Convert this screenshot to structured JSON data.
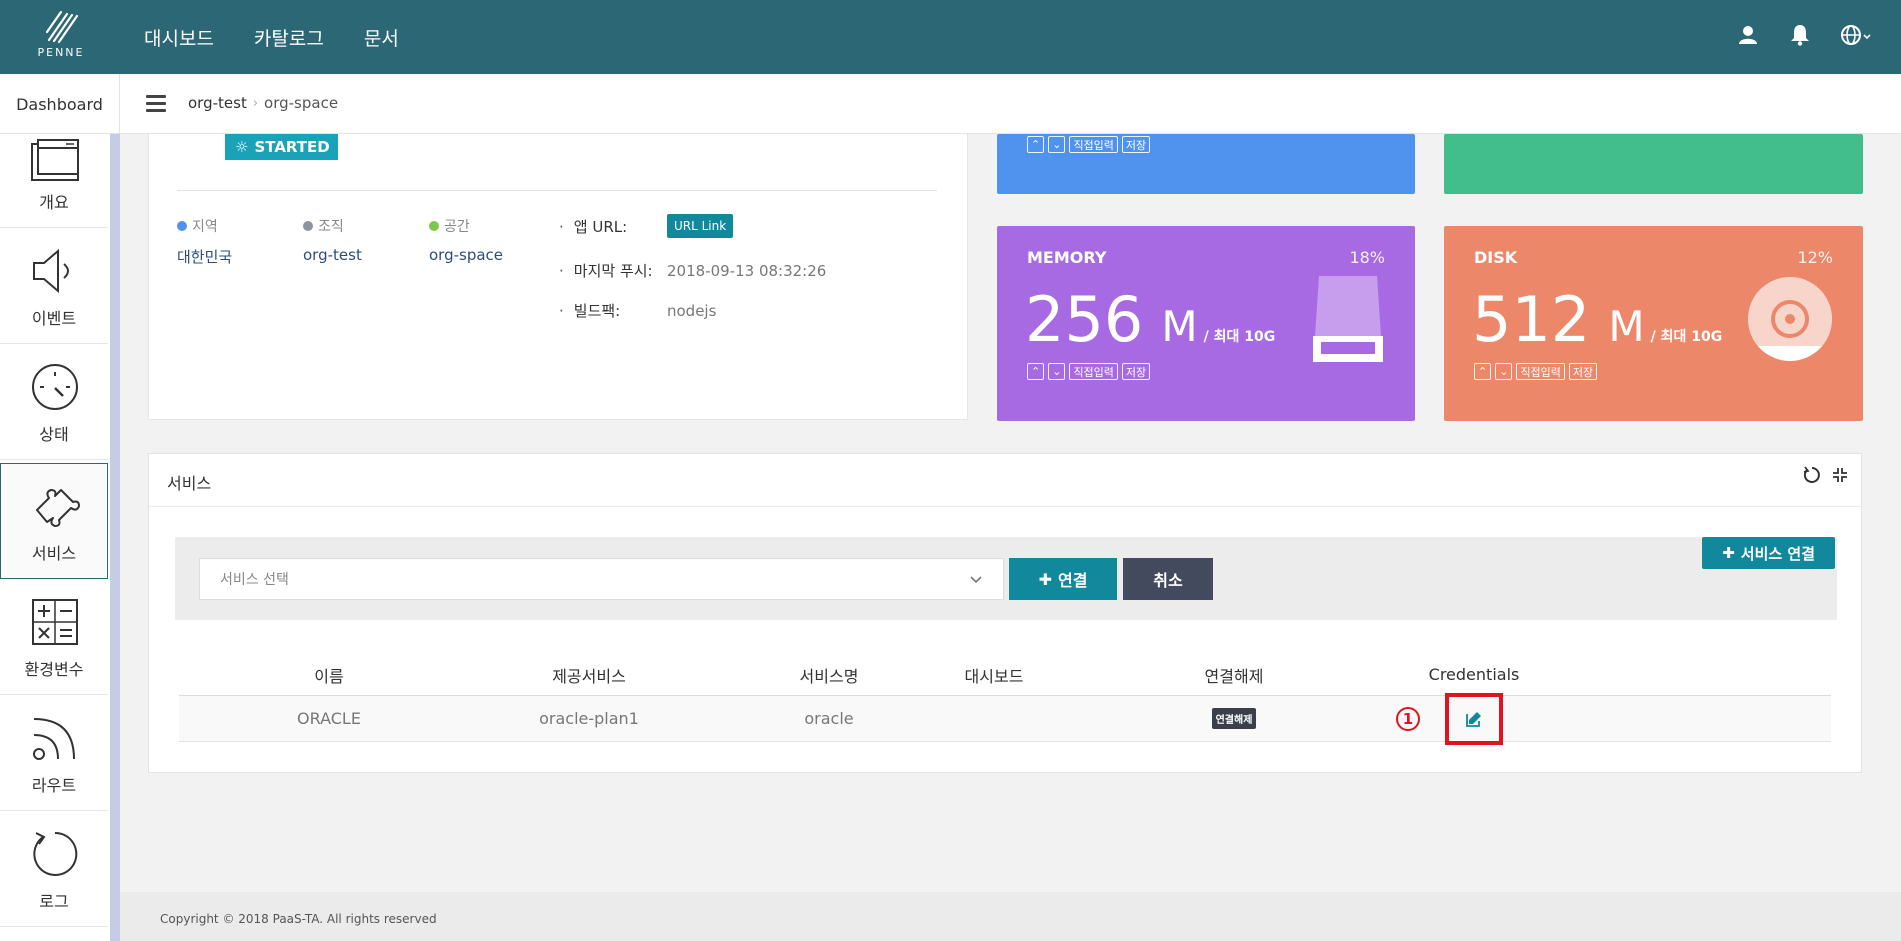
{
  "brand": {
    "logo_text": "PENNE"
  },
  "topnav": {
    "items": [
      "대시보드",
      "카탈로그",
      "문서"
    ]
  },
  "subheader": {
    "dashboard_label": "Dashboard",
    "breadcrumb": {
      "org": "org-test",
      "space": "org-space"
    }
  },
  "sidebar": {
    "items": [
      {
        "label": "개요",
        "icon": "window-icon"
      },
      {
        "label": "이벤트",
        "icon": "speaker-icon"
      },
      {
        "label": "상태",
        "icon": "gauge-icon"
      },
      {
        "label": "서비스",
        "icon": "puzzle-icon",
        "active": true
      },
      {
        "label": "환경변수",
        "icon": "calculator-icon"
      },
      {
        "label": "라우트",
        "icon": "rss-icon"
      },
      {
        "label": "로그",
        "icon": "refresh-icon"
      }
    ]
  },
  "app": {
    "status": "STARTED",
    "region": {
      "label": "지역",
      "value": "대한민국",
      "color": "#4f93ee"
    },
    "org": {
      "label": "조직",
      "value": "org-test",
      "color": "#8c93a3"
    },
    "space": {
      "label": "공간",
      "value": "org-space",
      "color": "#7bc94a"
    },
    "details": {
      "url_label": "앱 URL:",
      "url_button": "URL Link",
      "last_push_label": "마지막 푸시:",
      "last_push_value": "2018-09-13 08:32:26",
      "buildpack_label": "빌드팩:",
      "buildpack_value": "nodejs"
    }
  },
  "metrics": {
    "controls": {
      "direct_input": "직접입력",
      "save": "저장"
    },
    "memory": {
      "title": "MEMORY",
      "percent": "18%",
      "value": "256",
      "unit": "M",
      "max": "/ 최대 10G",
      "color": "#a86ae3"
    },
    "disk": {
      "title": "DISK",
      "percent": "12%",
      "value": "512",
      "unit": "M",
      "max": "/ 최대 10G",
      "color": "#ec876a"
    },
    "top_left_color": "#4f93ee",
    "top_right_color": "#42bd8c"
  },
  "services": {
    "title": "서비스",
    "add_button": "서비스 연결",
    "select_placeholder": "서비스 선택",
    "connect_button": "연결",
    "cancel_button": "취소",
    "columns": [
      "이름",
      "제공서비스",
      "서비스명",
      "대시보드",
      "연결해제",
      "Credentials"
    ],
    "rows": [
      {
        "name": "ORACLE",
        "provider": "oracle-plan1",
        "service_name": "oracle",
        "dashboard": "",
        "unbind": "연결해제"
      }
    ],
    "annotation": "1"
  },
  "footer": {
    "copyright": "Copyright © 2018 PaaS-TA. All rights reserved"
  }
}
